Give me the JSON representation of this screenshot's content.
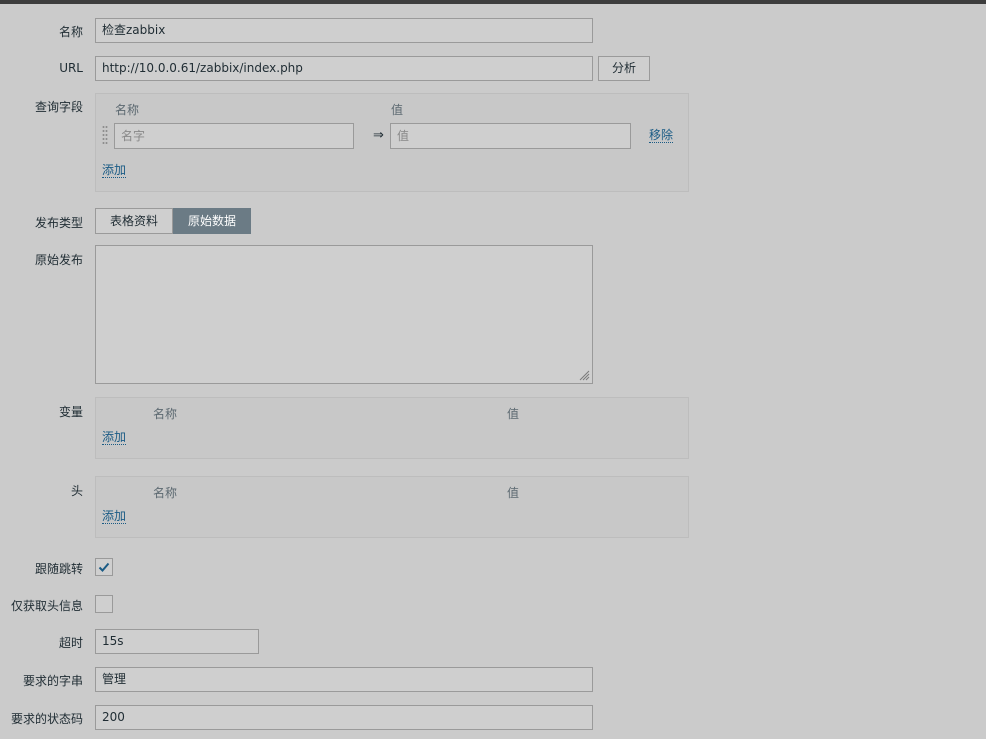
{
  "fields": {
    "name": {
      "label": "名称",
      "value": "检查zabbix"
    },
    "url": {
      "label": "URL",
      "value": "http://10.0.0.61/zabbix/index.php",
      "parse_button": "分析"
    },
    "query_fields": {
      "label": "查询字段",
      "col_name": "名称",
      "col_value": "值",
      "name_placeholder": "名字",
      "value_placeholder": "值",
      "remove": "移除",
      "add": "添加"
    },
    "post_type": {
      "label": "发布类型",
      "options": [
        "表格资料",
        "原始数据"
      ],
      "selected": "原始数据"
    },
    "raw_post": {
      "label": "原始发布",
      "value": ""
    },
    "variables": {
      "label": "变量",
      "col_name": "名称",
      "col_value": "值",
      "add": "添加"
    },
    "headers": {
      "label": "头",
      "col_name": "名称",
      "col_value": "值",
      "add": "添加"
    },
    "follow_redirects": {
      "label": "跟随跳转",
      "checked": true
    },
    "retrieve_headers_only": {
      "label": "仅获取头信息",
      "checked": false
    },
    "timeout": {
      "label": "超时",
      "value": "15s"
    },
    "required_string": {
      "label": "要求的字串",
      "value": "管理"
    },
    "required_status_codes": {
      "label": "要求的状态码",
      "value": "200"
    }
  },
  "icons": {
    "checkmark": "checkmark-icon",
    "drag": "drag-handle-icon",
    "arrow": "arrow-right-icon",
    "resize": "resize-grip-icon"
  }
}
